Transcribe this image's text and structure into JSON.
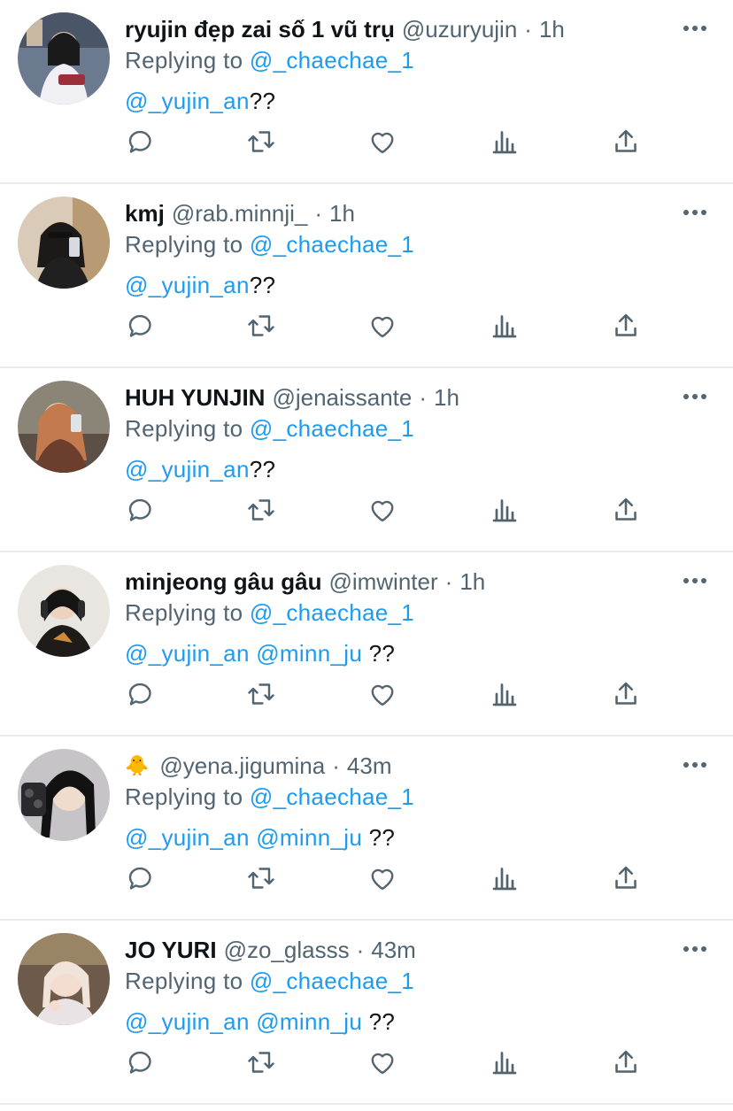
{
  "feed": {
    "tweets": [
      {
        "display_name": "ryujin đẹp zai số 1 vũ trụ",
        "handle": "@uzuryujin",
        "dot": "·",
        "time": "1h",
        "reply_prefix": "Replying to",
        "reply_to": "@_chaechae_1",
        "mentions": "@_yujin_an",
        "trail": "??"
      },
      {
        "display_name": "kmj",
        "handle": "@rab.minnji_",
        "dot": "·",
        "time": "1h",
        "reply_prefix": "Replying to",
        "reply_to": "@_chaechae_1",
        "mentions": "@_yujin_an",
        "trail": "??"
      },
      {
        "display_name": "HUH YUNJIN",
        "handle": "@jenaissante",
        "dot": "·",
        "time": "1h",
        "reply_prefix": "Replying to",
        "reply_to": "@_chaechae_1",
        "mentions": "@_yujin_an",
        "trail": "??"
      },
      {
        "display_name": "minjeong gâu gâu",
        "handle": "@imwinter",
        "dot": "·",
        "time": "1h",
        "reply_prefix": "Replying to",
        "reply_to": "@_chaechae_1",
        "mentions": "@_yujin_an @minn_ju",
        "trail": " ??"
      },
      {
        "display_name": "🐥",
        "handle": "@yena.jigumina",
        "dot": "·",
        "time": "43m",
        "reply_prefix": "Replying to",
        "reply_to": "@_chaechae_1",
        "mentions": "@_yujin_an @minn_ju",
        "trail": " ??"
      },
      {
        "display_name": "JO YURI",
        "handle": "@zo_glasss",
        "dot": "·",
        "time": "43m",
        "reply_prefix": "Replying to",
        "reply_to": "@_chaechae_1",
        "mentions": "@_yujin_an @minn_ju",
        "trail": " ??"
      }
    ]
  },
  "icons": {
    "reply": "reply-icon",
    "retweet": "retweet-icon",
    "like": "like-icon",
    "views": "views-icon",
    "share": "share-icon",
    "more": "more-icon"
  },
  "colors": {
    "link": "#1d9bf0",
    "secondary_text": "#536471",
    "primary_text": "#0f1419",
    "divider": "#e6ecf0"
  }
}
